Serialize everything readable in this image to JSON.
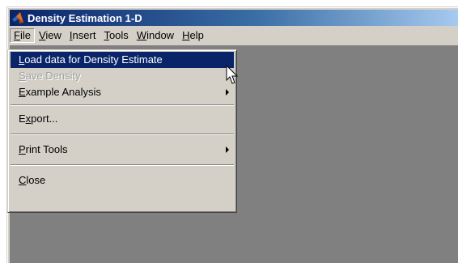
{
  "window": {
    "title": "Density Estimation 1-D",
    "app_icon": "matlab-logo-icon"
  },
  "menubar": [
    {
      "pre": "",
      "key": "F",
      "post": "ile"
    },
    {
      "pre": "",
      "key": "V",
      "post": "iew"
    },
    {
      "pre": "",
      "key": "I",
      "post": "nsert"
    },
    {
      "pre": "",
      "key": "T",
      "post": "ools"
    },
    {
      "pre": "",
      "key": "W",
      "post": "indow"
    },
    {
      "pre": "",
      "key": "H",
      "post": "elp"
    }
  ],
  "file_menu": {
    "load": {
      "pre": "",
      "key": "L",
      "post": "oad data for Density Estimate"
    },
    "save": {
      "pre": "",
      "key": "S",
      "post": "ave Density"
    },
    "example": {
      "pre": "",
      "key": "E",
      "post": "xample Analysis"
    },
    "export": {
      "pre": "E",
      "key": "x",
      "post": "port..."
    },
    "print": {
      "pre": "",
      "key": "P",
      "post": "rint Tools"
    },
    "close": {
      "pre": "",
      "key": "C",
      "post": "lose"
    }
  },
  "colors": {
    "titlebar_start": "#0a246a",
    "titlebar_end": "#a6caf0",
    "highlight": "#0a246a",
    "face": "#d4d0c8",
    "canvas": "#808080"
  }
}
